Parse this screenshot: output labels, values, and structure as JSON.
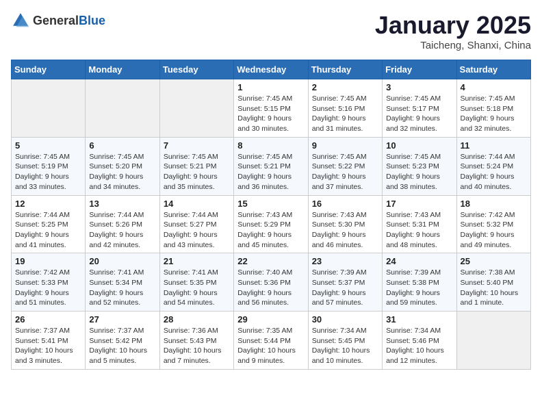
{
  "header": {
    "logo_general": "General",
    "logo_blue": "Blue",
    "month": "January 2025",
    "location": "Taicheng, Shanxi, China"
  },
  "days_of_week": [
    "Sunday",
    "Monday",
    "Tuesday",
    "Wednesday",
    "Thursday",
    "Friday",
    "Saturday"
  ],
  "weeks": [
    [
      {
        "day": "",
        "info": ""
      },
      {
        "day": "",
        "info": ""
      },
      {
        "day": "",
        "info": ""
      },
      {
        "day": "1",
        "info": "Sunrise: 7:45 AM\nSunset: 5:15 PM\nDaylight: 9 hours and 30 minutes."
      },
      {
        "day": "2",
        "info": "Sunrise: 7:45 AM\nSunset: 5:16 PM\nDaylight: 9 hours and 31 minutes."
      },
      {
        "day": "3",
        "info": "Sunrise: 7:45 AM\nSunset: 5:17 PM\nDaylight: 9 hours and 32 minutes."
      },
      {
        "day": "4",
        "info": "Sunrise: 7:45 AM\nSunset: 5:18 PM\nDaylight: 9 hours and 32 minutes."
      }
    ],
    [
      {
        "day": "5",
        "info": "Sunrise: 7:45 AM\nSunset: 5:19 PM\nDaylight: 9 hours and 33 minutes."
      },
      {
        "day": "6",
        "info": "Sunrise: 7:45 AM\nSunset: 5:20 PM\nDaylight: 9 hours and 34 minutes."
      },
      {
        "day": "7",
        "info": "Sunrise: 7:45 AM\nSunset: 5:21 PM\nDaylight: 9 hours and 35 minutes."
      },
      {
        "day": "8",
        "info": "Sunrise: 7:45 AM\nSunset: 5:21 PM\nDaylight: 9 hours and 36 minutes."
      },
      {
        "day": "9",
        "info": "Sunrise: 7:45 AM\nSunset: 5:22 PM\nDaylight: 9 hours and 37 minutes."
      },
      {
        "day": "10",
        "info": "Sunrise: 7:45 AM\nSunset: 5:23 PM\nDaylight: 9 hours and 38 minutes."
      },
      {
        "day": "11",
        "info": "Sunrise: 7:44 AM\nSunset: 5:24 PM\nDaylight: 9 hours and 40 minutes."
      }
    ],
    [
      {
        "day": "12",
        "info": "Sunrise: 7:44 AM\nSunset: 5:25 PM\nDaylight: 9 hours and 41 minutes."
      },
      {
        "day": "13",
        "info": "Sunrise: 7:44 AM\nSunset: 5:26 PM\nDaylight: 9 hours and 42 minutes."
      },
      {
        "day": "14",
        "info": "Sunrise: 7:44 AM\nSunset: 5:27 PM\nDaylight: 9 hours and 43 minutes."
      },
      {
        "day": "15",
        "info": "Sunrise: 7:43 AM\nSunset: 5:29 PM\nDaylight: 9 hours and 45 minutes."
      },
      {
        "day": "16",
        "info": "Sunrise: 7:43 AM\nSunset: 5:30 PM\nDaylight: 9 hours and 46 minutes."
      },
      {
        "day": "17",
        "info": "Sunrise: 7:43 AM\nSunset: 5:31 PM\nDaylight: 9 hours and 48 minutes."
      },
      {
        "day": "18",
        "info": "Sunrise: 7:42 AM\nSunset: 5:32 PM\nDaylight: 9 hours and 49 minutes."
      }
    ],
    [
      {
        "day": "19",
        "info": "Sunrise: 7:42 AM\nSunset: 5:33 PM\nDaylight: 9 hours and 51 minutes."
      },
      {
        "day": "20",
        "info": "Sunrise: 7:41 AM\nSunset: 5:34 PM\nDaylight: 9 hours and 52 minutes."
      },
      {
        "day": "21",
        "info": "Sunrise: 7:41 AM\nSunset: 5:35 PM\nDaylight: 9 hours and 54 minutes."
      },
      {
        "day": "22",
        "info": "Sunrise: 7:40 AM\nSunset: 5:36 PM\nDaylight: 9 hours and 56 minutes."
      },
      {
        "day": "23",
        "info": "Sunrise: 7:39 AM\nSunset: 5:37 PM\nDaylight: 9 hours and 57 minutes."
      },
      {
        "day": "24",
        "info": "Sunrise: 7:39 AM\nSunset: 5:38 PM\nDaylight: 9 hours and 59 minutes."
      },
      {
        "day": "25",
        "info": "Sunrise: 7:38 AM\nSunset: 5:40 PM\nDaylight: 10 hours and 1 minute."
      }
    ],
    [
      {
        "day": "26",
        "info": "Sunrise: 7:37 AM\nSunset: 5:41 PM\nDaylight: 10 hours and 3 minutes."
      },
      {
        "day": "27",
        "info": "Sunrise: 7:37 AM\nSunset: 5:42 PM\nDaylight: 10 hours and 5 minutes."
      },
      {
        "day": "28",
        "info": "Sunrise: 7:36 AM\nSunset: 5:43 PM\nDaylight: 10 hours and 7 minutes."
      },
      {
        "day": "29",
        "info": "Sunrise: 7:35 AM\nSunset: 5:44 PM\nDaylight: 10 hours and 9 minutes."
      },
      {
        "day": "30",
        "info": "Sunrise: 7:34 AM\nSunset: 5:45 PM\nDaylight: 10 hours and 10 minutes."
      },
      {
        "day": "31",
        "info": "Sunrise: 7:34 AM\nSunset: 5:46 PM\nDaylight: 10 hours and 12 minutes."
      },
      {
        "day": "",
        "info": ""
      }
    ]
  ]
}
